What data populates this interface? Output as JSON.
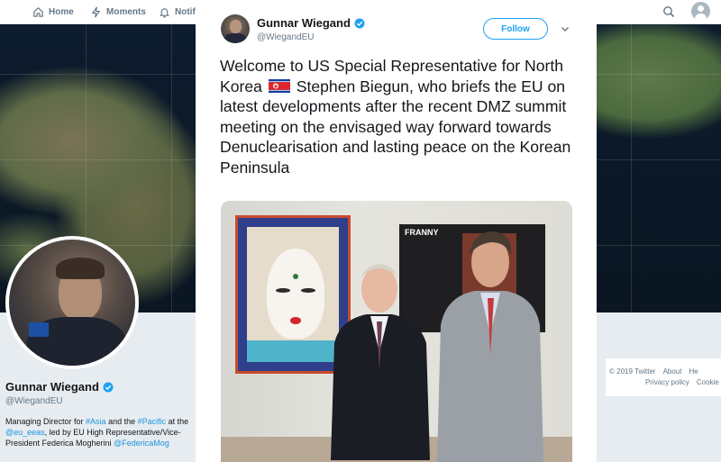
{
  "nav": {
    "home": "Home",
    "moments": "Moments",
    "notifications_partial": "Notif"
  },
  "profile": {
    "name": "Gunnar Wiegand",
    "handle": "@WiegandEU",
    "bio": {
      "p1": "Managing Director for ",
      "link_asia": "#Asia",
      "p2": " and the ",
      "link_pacific": "#Pacific",
      "p3": " at the ",
      "link_eeas": "@eu_eeas",
      "p4": ", led by EU High Representative/Vice-President Federica Mogherini ",
      "link_mogherini": "@FedericaMog"
    }
  },
  "tweet": {
    "author_name": "Gunnar Wiegand",
    "author_handle": "@WiegandEU",
    "follow_label": "Follow",
    "text_before_flag": "Welcome to US Special Representative for North Korea",
    "text_after_flag": "Stephen Biegun, who briefs the EU on latest developments after the recent DMZ summit meeting on the envisaged way forward towards Denuclearisation and lasting peace on the Korean Peninsula",
    "poster_text": "FRANNY"
  },
  "footer": {
    "copyright": "© 2019 Twitter",
    "about": "About",
    "help_partial": "He",
    "privacy": "Privacy policy",
    "cookies_partial": "Cookie"
  },
  "colors": {
    "accent": "#1da1f2",
    "verified": "#1da1f2",
    "link": "#1b95e0",
    "text": "#14171a",
    "muted": "#657786",
    "background": "#e6ecf0"
  },
  "icons": {
    "home": "home-icon",
    "moments": "lightning-icon",
    "notifications": "bell-icon",
    "search": "search-icon",
    "verified": "verified-badge-icon",
    "caret": "chevron-down-icon",
    "flag": "north-korea-flag-icon"
  }
}
